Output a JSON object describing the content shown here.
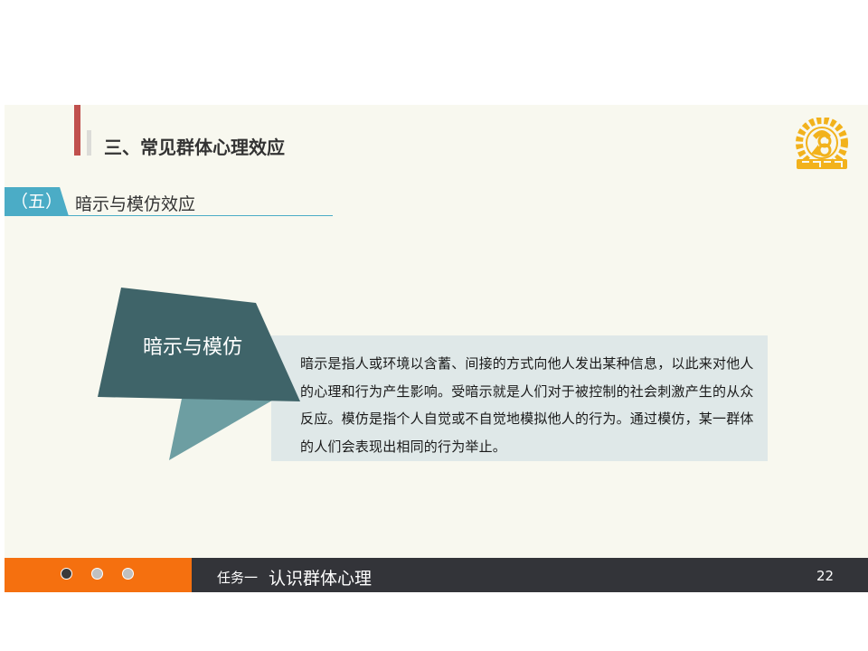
{
  "header": {
    "section_title": "三、常见群体心理效应"
  },
  "subsection": {
    "number": "（五）",
    "title": "暗示与模仿效应"
  },
  "content": {
    "label": "暗示与模仿",
    "paragraph": "暗示是指人或环境以含蓄、间接的方式向他人发出某种信息，以此来对他人的心理和行为产生影响。受暗示就是人们对于被控制的社会刺激产生的从众反应。模仿是指个人自觉或不自觉地模拟他人的行为。通过模仿，某一群体的人们会表现出相同的行为举止。"
  },
  "footer": {
    "task": "任务一",
    "name": "认识群体心理",
    "page": "22",
    "dots": [
      {
        "state": "active"
      },
      {
        "state": "inactive"
      },
      {
        "state": "inactive"
      }
    ]
  },
  "colors": {
    "accent_red": "#c0504d",
    "accent_blue": "#4bacc6",
    "dark_teal": "#3f6469",
    "light_teal": "#6d9ea2",
    "orange": "#f5700f",
    "footer_dark": "#333439",
    "logo_gold": "#f2b21c"
  },
  "icons": {
    "logo": "company-logo-icon"
  }
}
